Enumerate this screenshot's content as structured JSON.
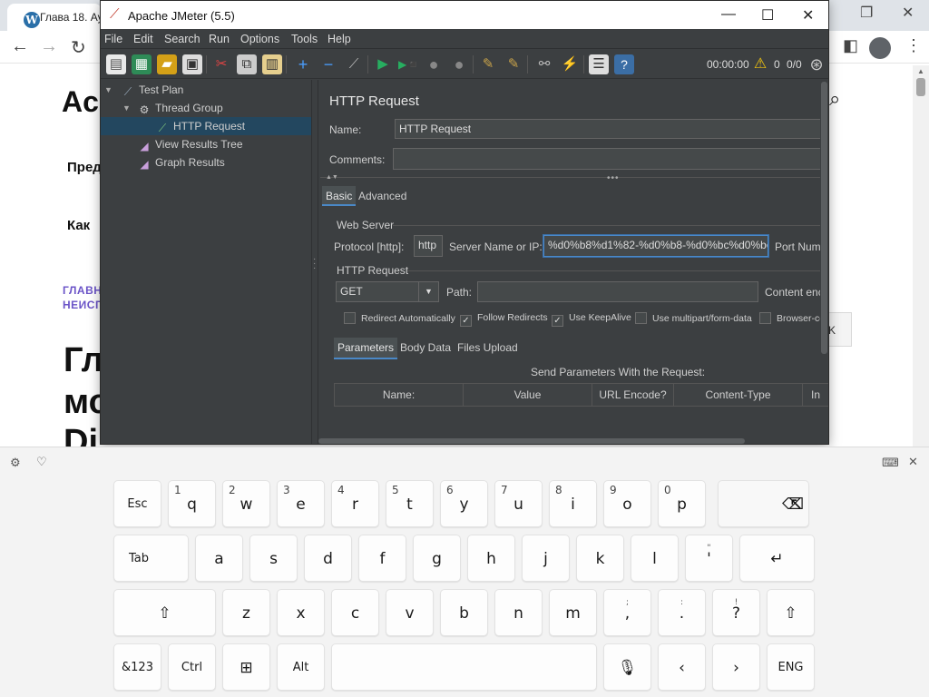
{
  "browser": {
    "tab_title": "Глава 18. Ау",
    "page_heading_1": "Ac",
    "page_text_2": "Пред",
    "page_text_3": "Как",
    "link_1": "ГЛАВН",
    "link_2": "НЕИСП",
    "big_1": "Гл",
    "big_2": "мо",
    "big_3": "Di",
    "ghost_button": "K"
  },
  "jmeter": {
    "window_title": "Apache JMeter (5.5)",
    "menu": [
      "File",
      "Edit",
      "Search",
      "Run",
      "Options",
      "Tools",
      "Help"
    ],
    "timer": "00:00:00",
    "warnings": "0",
    "threads": "0/0",
    "tree": [
      {
        "label": "Test Plan"
      },
      {
        "label": "Thread Group"
      },
      {
        "label": "HTTP Request"
      },
      {
        "label": "View Results Tree"
      },
      {
        "label": "Graph Results"
      }
    ],
    "editor": {
      "heading": "HTTP Request",
      "name_label": "Name:",
      "name_value": "HTTP Request",
      "comments_label": "Comments:",
      "comments_value": "",
      "tab_basic": "Basic",
      "tab_advanced": "Advanced",
      "web_server_label": "Web Server",
      "protocol_label": "Protocol [http]:",
      "protocol_value": "http",
      "server_label": "Server Name or IP:",
      "server_value": "%d0%b8%d1%82-%d0%b8-%d0%bc%d0%be",
      "port_label": "Port Num",
      "http_request_label": "HTTP Request",
      "method_value": "GET",
      "path_label": "Path:",
      "path_value": "",
      "content_enc_label": "Content enc",
      "checkboxes": [
        {
          "label": "Redirect Automatically",
          "checked": false
        },
        {
          "label": "Follow Redirects",
          "checked": true
        },
        {
          "label": "Use KeepAlive",
          "checked": true
        },
        {
          "label": "Use multipart/form-data",
          "checked": false
        },
        {
          "label": "Browser-co",
          "checked": false
        }
      ],
      "sub_tab_parameters": "Parameters",
      "sub_tab_body": "Body Data",
      "sub_tab_files": "Files Upload",
      "send_params": "Send Parameters With the Request:",
      "columns": [
        "Name:",
        "Value",
        "URL Encode?",
        "Content-Type",
        "In"
      ]
    }
  },
  "keyboard": {
    "row1": [
      {
        "label": "Esc"
      },
      {
        "label": "q",
        "num": "1"
      },
      {
        "label": "w",
        "num": "2"
      },
      {
        "label": "e",
        "num": "3"
      },
      {
        "label": "r",
        "num": "4"
      },
      {
        "label": "t",
        "num": "5"
      },
      {
        "label": "y",
        "num": "6"
      },
      {
        "label": "u",
        "num": "7"
      },
      {
        "label": "i",
        "num": "8"
      },
      {
        "label": "o",
        "num": "9"
      },
      {
        "label": "p",
        "num": "0"
      }
    ],
    "row2": [
      "Tab",
      "a",
      "s",
      "d",
      "f",
      "g",
      "h",
      "j",
      "k",
      "l",
      "'"
    ],
    "row2_sub": "\"",
    "row3": [
      "z",
      "x",
      "c",
      "v",
      "b",
      "n",
      "m",
      ",",
      ".",
      "?"
    ],
    "row3_sub": [
      ";",
      ":",
      "!"
    ],
    "row4": [
      "&123",
      "Ctrl",
      "Alt",
      "ENG"
    ]
  },
  "icons": {
    "backspace": "backspace-icon",
    "enter": "enter-icon",
    "shift": "shift-icon",
    "windows": "windows-icon",
    "mic": "mic-icon"
  }
}
